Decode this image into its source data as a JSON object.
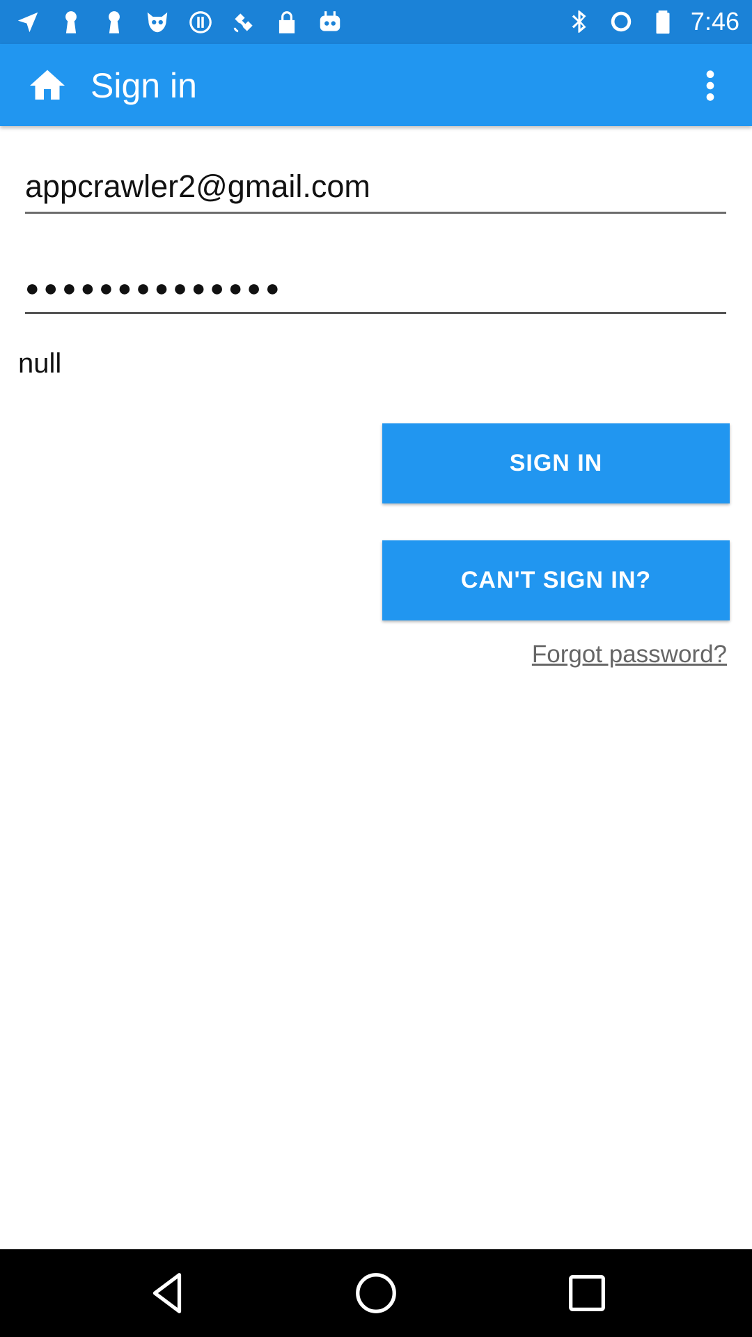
{
  "status_bar": {
    "time": "7:46",
    "left_icons": [
      "navigation-icon",
      "keyhole-icon",
      "keyhole-icon",
      "cat-face-icon",
      "circle-info-icon",
      "satellite-icon",
      "lock-icon",
      "robot-icon"
    ],
    "right_icons": [
      "bluetooth-icon",
      "ring-icon",
      "battery-icon"
    ]
  },
  "app_bar": {
    "title": "Sign in",
    "home_icon": "home-icon",
    "menu_icon": "overflow-menu-icon"
  },
  "form": {
    "email_value": "appcrawler2@gmail.com",
    "password_value": "●●●●●●●●●●●●●●",
    "status_text": "null",
    "sign_in_label": "SIGN IN",
    "cant_sign_in_label": "CAN'T SIGN IN?",
    "forgot_label": "Forgot password?"
  },
  "colors": {
    "status_bar": "#1b82d7",
    "app_bar": "#2196f0",
    "button": "#2196f0",
    "link": "#666666",
    "nav_bar": "#000000"
  },
  "nav_bar": {
    "icons": [
      "back-icon",
      "home-circle-icon",
      "recent-apps-icon"
    ]
  }
}
